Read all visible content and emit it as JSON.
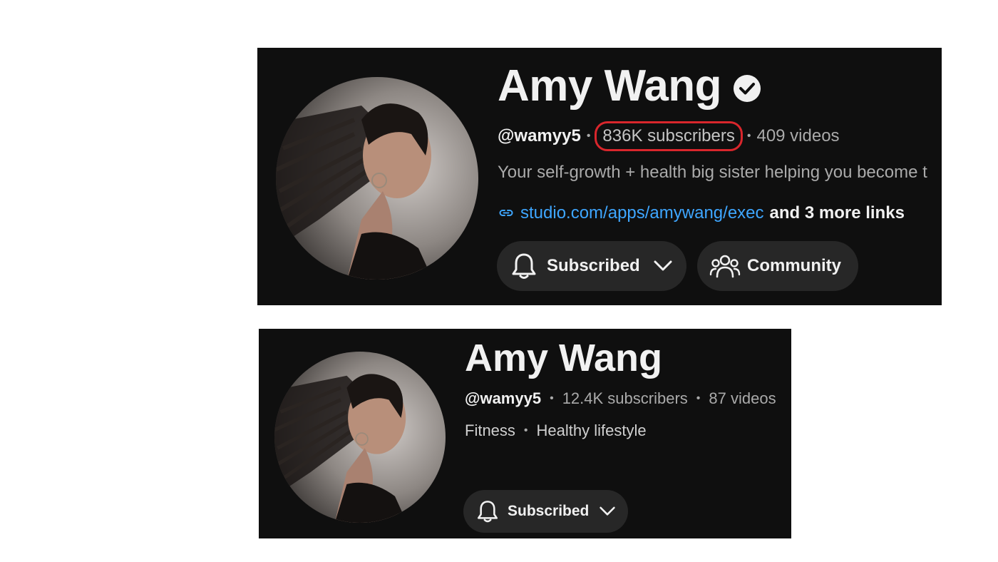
{
  "card_large": {
    "channel_name": "Amy Wang",
    "verified_icon": "verified-check-icon",
    "handle": "@wamyy5",
    "subscribers": "836K subscribers",
    "subscribers_highlight_color": "#d9262c",
    "videos": "409 videos",
    "description": "Your self-growth + health big sister helping you become t",
    "link_text": "studio.com/apps/amywang/exec",
    "more_links": "and 3 more links",
    "subscribe_button_label": "Subscribed",
    "community_button_label": "Community"
  },
  "card_small": {
    "channel_name": "Amy Wang",
    "handle": "@wamyy5",
    "subscribers": "12.4K subscribers",
    "videos": "87 videos",
    "tag_1": "Fitness",
    "tag_2": "Healthy lifestyle",
    "subscribe_button_label": "Subscribed"
  },
  "colors": {
    "card_background": "#0f0f0f",
    "link_blue": "#3ea6ff",
    "button_background": "#272727"
  }
}
